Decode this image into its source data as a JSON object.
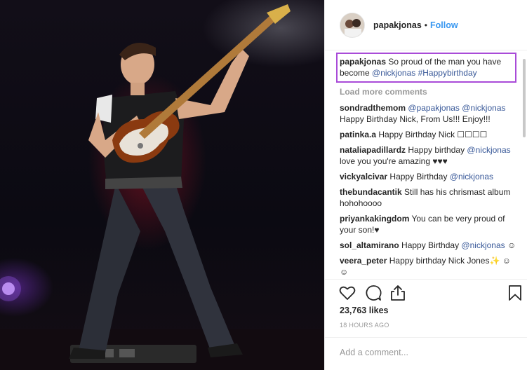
{
  "post": {
    "username": "papakjonas",
    "follow_label": "Follow",
    "separator": "•"
  },
  "caption": {
    "username": "papakjonas",
    "text": " So proud of the man you have become ",
    "mention": "@nickjonas",
    "hashtag": "#Happybirthday"
  },
  "load_more_label": "Load more comments",
  "comments": [
    {
      "user": "sondradthemom",
      "parts": [
        {
          "t": " "
        },
        {
          "t": "@papakjonas",
          "link": true
        },
        {
          "t": " "
        },
        {
          "t": "@nickjonas",
          "link": true
        },
        {
          "t": " Happy Birthday Nick, From Us!!! Enjoy!!!"
        }
      ]
    },
    {
      "user": "patinka.a",
      "parts": [
        {
          "t": " Happy Birthday Nick ☐☐☐☐"
        }
      ]
    },
    {
      "user": "nataliapadillardz",
      "parts": [
        {
          "t": " Happy birthday "
        },
        {
          "t": "@nickjonas",
          "link": true
        },
        {
          "t": " love you you're amazing ♥♥♥"
        }
      ]
    },
    {
      "user": "vickyalcivar",
      "parts": [
        {
          "t": " Happy Birthday "
        },
        {
          "t": "@nickjonas",
          "link": true
        }
      ]
    },
    {
      "user": "thebundacantik",
      "parts": [
        {
          "t": " Still has his chrismast album hohohoooo"
        }
      ]
    },
    {
      "user": "priyankakingdom",
      "parts": [
        {
          "t": " You can be very proud of your son!♥"
        }
      ]
    },
    {
      "user": "sol_altamirano",
      "parts": [
        {
          "t": " Happy Birthday "
        },
        {
          "t": "@nickjonas",
          "link": true
        },
        {
          "t": " ☺"
        }
      ]
    },
    {
      "user": "veera_peter",
      "parts": [
        {
          "t": " Happy birthday Nick Jones✨ ☺ ☺"
        }
      ]
    }
  ],
  "likes_text": "23,763 likes",
  "time_text": "18 HOURS AGO",
  "add_comment_placeholder": "Add a comment...",
  "icons": {
    "like": "heart-icon",
    "comment": "comment-icon",
    "share": "share-icon",
    "save": "bookmark-icon"
  },
  "colors": {
    "link": "#385898",
    "follow": "#3897f0",
    "highlight_border": "#a94bd8",
    "muted": "#999999"
  }
}
